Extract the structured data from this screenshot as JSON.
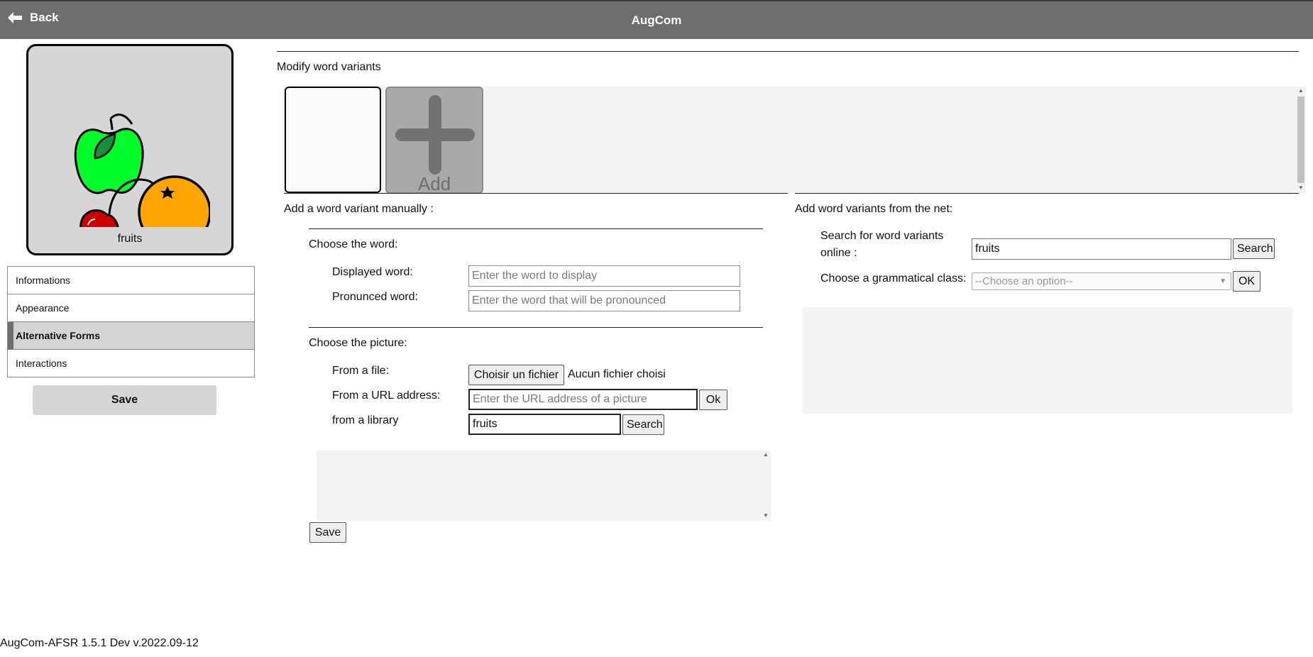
{
  "header": {
    "back_label": "Back",
    "title": "AugCom"
  },
  "tile": {
    "label": "fruits"
  },
  "menu": {
    "items": [
      {
        "label": "Informations"
      },
      {
        "label": "Appearance"
      },
      {
        "label": "Alternative Forms"
      },
      {
        "label": "Interactions"
      }
    ],
    "save_label": "Save"
  },
  "variants": {
    "title": "Modify word variants",
    "add_label": "Add"
  },
  "manual": {
    "title": "Add a word variant manually :",
    "choose_word": "Choose the word:",
    "displayed_label": "Displayed word:",
    "displayed_placeholder": "Enter the word to display",
    "pronounced_label": "Pronunced word:",
    "pronounced_placeholder": "Enter the word that will be pronounced",
    "choose_picture": "Choose the picture:",
    "file_label": "From a file:",
    "file_button": "Choisir un fichier",
    "file_status": "Aucun fichier choisi",
    "url_label": "From a URL address:",
    "url_placeholder": "Enter the URL address of a picture",
    "url_button": "Ok",
    "library_label": "from a library",
    "library_value": "fruits",
    "library_button": "Search",
    "save_button": "Save"
  },
  "net": {
    "title": "Add word variants from the net:",
    "search_label_line1": "Search for word variants",
    "search_label_line2": "online :",
    "search_value": "fruits",
    "search_button": "Search",
    "class_label": "Choose a grammatical class:",
    "class_selected": "--Choose an option--",
    "ok_button": "OK"
  },
  "footer": {
    "version": "AugCom-AFSR 1.5.1 Dev v.2022.09-12"
  },
  "colors": {
    "header_bg": "#6e6e6e",
    "tile_bg": "#d6d6d6",
    "apple": "#00ff2a",
    "cherry": "#cc0000",
    "orange": "#ffa500"
  }
}
